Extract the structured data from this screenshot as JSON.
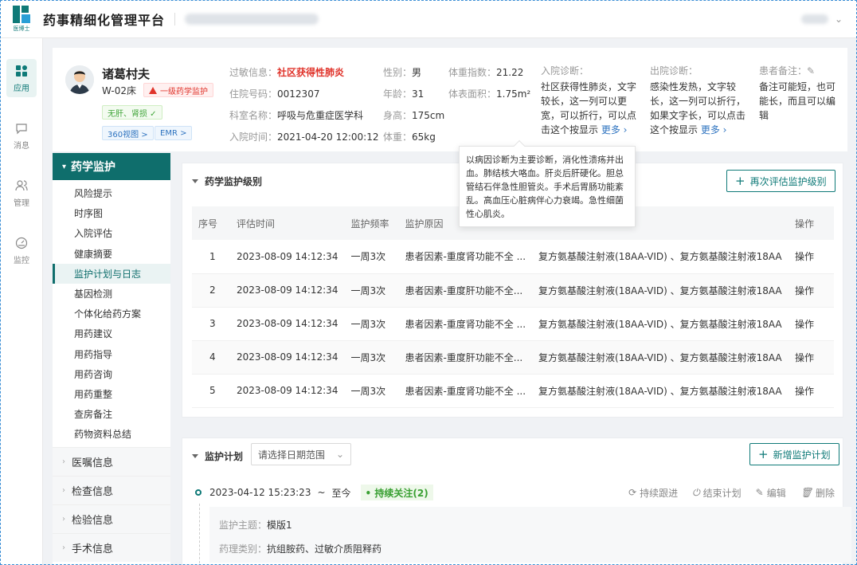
{
  "header": {
    "logo_text": "医博士",
    "app_title": "药事精细化管理平台",
    "org_name_redacted": "",
    "user_redacted": ""
  },
  "nav": [
    {
      "label": "应用",
      "icon": "apps-grid-icon",
      "active": true
    },
    {
      "label": "消息",
      "icon": "message-icon",
      "active": false
    },
    {
      "label": "管理",
      "icon": "users-icon",
      "active": false
    },
    {
      "label": "监控",
      "icon": "gauge-icon",
      "active": false
    }
  ],
  "patient": {
    "name": "诸葛村夫",
    "bed": "W-02床",
    "monitor_level": "一级药学监护",
    "tag_ok": "无肝、肾损 ✓",
    "link_360": "360视图 >",
    "link_emr": "EMR >",
    "allergy_label": "过敏信息：",
    "allergy_value": "社区获得性肺炎",
    "admission_no_label": "住院号码：",
    "admission_no_value": "0012307",
    "dept_label": "科室名称：",
    "dept_value": "呼吸与危重症医学科",
    "admit_time_label": "入院时间：",
    "admit_time_value": "2021-04-20 12:00:12",
    "sex_label": "性别：",
    "sex_value": "男",
    "age_label": "年龄：",
    "age_value": "31",
    "height_label": "身高：",
    "height_value": "175cm",
    "weight_label": "体重：",
    "weight_value": "65kg",
    "bmi_label": "体重指数：",
    "bmi_value": "21.22",
    "bsa_label": "体表面积：",
    "bsa_value": "1.75m²",
    "in_diag_label": "入院诊断：",
    "in_diag_text": "社区获得性肺炎，文字较长，这一列可以更宽，可以折行，可以点击这个按显示",
    "in_diag_more": "更多 ›",
    "out_diag_label": "出院诊断：",
    "out_diag_text": "感染性发热，文字较长，这一列可以折行，如果文字长，可以点击这个按显示",
    "out_diag_more": "更多 ›",
    "note_label": "患者备注：",
    "note_text": "备注可能短，也可能长，而且可以编辑"
  },
  "tooltip": {
    "text": "以病因诊断为主要诊断，消化性溃疡并出血。肺结核大咯血。肝炎后肝硬化。胆总管结石伴急性胆管炎。手术后胃肠功能紊乱。高血压心脏病伴心力衰竭。急性细菌性心肌炎。"
  },
  "submenu": {
    "section_title": "药学监护",
    "items": [
      "风险提示",
      "时序图",
      "入院评估",
      "健康摘要",
      "监护计划与日志",
      "基因检测",
      "个体化给药方案",
      "用药建议",
      "用药指导",
      "用药咨询",
      "用药重整",
      "查房备注",
      "药物资料总结"
    ],
    "active_index": 4,
    "groups": [
      "医嘱信息",
      "检查信息",
      "检验信息",
      "手术信息"
    ]
  },
  "level_panel": {
    "title": "药学监护级别",
    "button": "再次评估监护级别",
    "columns": [
      "序号",
      "评估时间",
      "监护频率",
      "监护原因",
      "",
      "操作"
    ],
    "rows": [
      {
        "no": "1",
        "time": "2023-08-09 14:12:34",
        "freq": "一周3次",
        "reason": "患者因素-重度肾功能不全 ...",
        "drug": "复方氨基酸注射液(18AA-VID) 、复方氨基酸注射液18AA",
        "op": "操作"
      },
      {
        "no": "2",
        "time": "2023-08-09 14:12:34",
        "freq": "一周3次",
        "reason": "患者因素-重度肝功能不全...",
        "drug": "复方氨基酸注射液(18AA-VID) 、复方氨基酸注射液18AA",
        "op": "操作"
      },
      {
        "no": "3",
        "time": "2023-08-09 14:12:34",
        "freq": "一周3次",
        "reason": "患者因素-重度肾功能不全 ...",
        "drug": "复方氨基酸注射液(18AA-VID) 、复方氨基酸注射液18AA",
        "op": "操作"
      },
      {
        "no": "4",
        "time": "2023-08-09 14:12:34",
        "freq": "一周3次",
        "reason": "患者因素-重度肝功能不全...",
        "drug": "复方氨基酸注射液(18AA-VID) 、复方氨基酸注射液18AA",
        "op": "操作"
      },
      {
        "no": "5",
        "time": "2023-08-09 14:12:34",
        "freq": "一周3次",
        "reason": "患者因素-重度肾功能不全 ...",
        "drug": "复方氨基酸注射液(18AA-VID) 、复方氨基酸注射液18AA",
        "op": "操作"
      }
    ]
  },
  "plan_panel": {
    "title": "监护计划",
    "date_placeholder": "请选择日期范围",
    "button": "新增监护计划",
    "entry": {
      "start": "2023-04-12 15:23:23",
      "sep": "~",
      "end": "至今",
      "status": "• 持续关注(2)",
      "actions": [
        "持续跟进",
        "结束计划",
        "编辑",
        "删除"
      ],
      "topic_label": "监护主题：",
      "topic_value": "模版1",
      "pharm_label": "药理类别：",
      "pharm_value": "抗组胺药、过敏介质阻释药"
    }
  },
  "colors": {
    "primary": "#0f7a78",
    "danger": "#e0342b",
    "link": "#2f74c0",
    "success": "#3aa033"
  }
}
